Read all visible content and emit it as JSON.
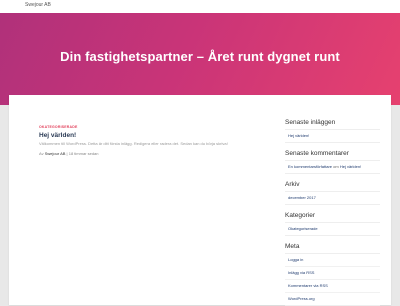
{
  "header": {
    "site_name": "Swejour AB"
  },
  "hero": {
    "title": "Din fastighetspartner – Året runt dygnet runt"
  },
  "post": {
    "category": "OKATEGORISERADE",
    "title": "Hej världen!",
    "excerpt": "Välkommen till WordPress. Detta är ditt första inlägg. Redigera eller radera det. Sedan kan du börja skriva!",
    "meta_prefix": "Av",
    "author": "Swejour AB",
    "date": "18 timmar sedan"
  },
  "sidebar": {
    "recent_posts": {
      "title": "Senaste inläggen",
      "items": [
        "Hej världen!"
      ]
    },
    "recent_comments": {
      "title": "Senaste kommentarer",
      "commenter": "En kommentarsförfattare",
      "on_text": "om",
      "post": "Hej världen!"
    },
    "archive": {
      "title": "Arkiv",
      "items": [
        "december 2017"
      ]
    },
    "categories": {
      "title": "Kategorier",
      "items": [
        "Okategoriserade"
      ]
    },
    "meta": {
      "title": "Meta",
      "items": [
        "Logga in",
        "Inlägg via RSS",
        "Kommentarer via RSS",
        "WordPress.org"
      ]
    }
  }
}
